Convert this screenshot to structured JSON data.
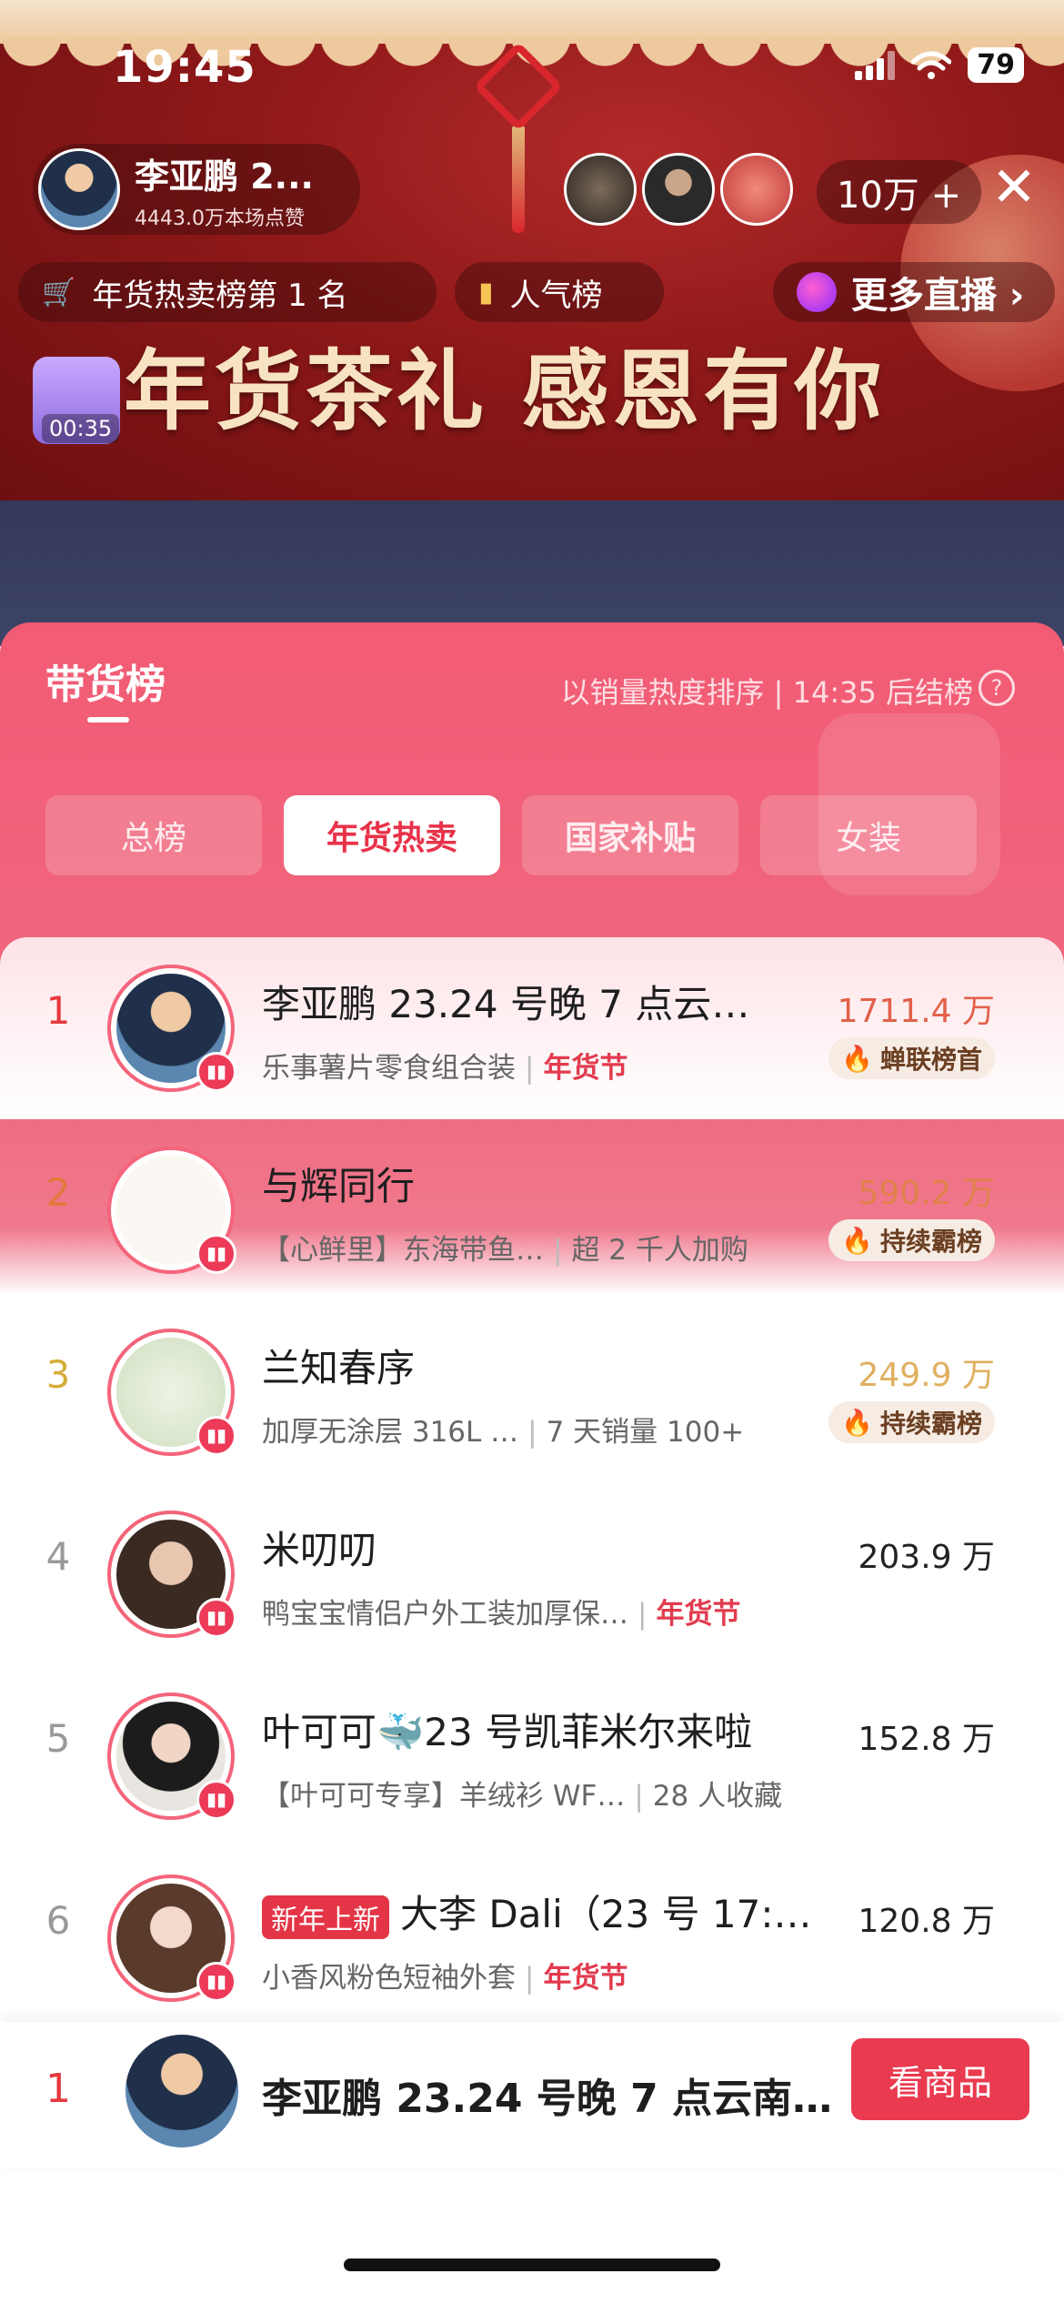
{
  "status_bar": {
    "time": "19:45",
    "battery": "79"
  },
  "host": {
    "name": "李亚鹏 2...",
    "likes": "4443.0万本场点赞"
  },
  "viewer_count": "10万 +",
  "chips": {
    "rank": "年货热卖榜第 1 名",
    "popularity": "人气榜",
    "more_live": "更多直播 ›"
  },
  "promo_text": "年货茶礼 感恩有你",
  "bag_timer": "00:35",
  "panel": {
    "title": "带货榜",
    "sort_text": "以销量热度排序 | 14:35 后结榜",
    "help": "?",
    "tabs": [
      "总榜",
      "年货热卖",
      "国家补贴",
      "女装"
    ]
  },
  "rankings": [
    {
      "rank": "1",
      "name": "李亚鹏 23.24 号晚 7 点云…",
      "desc": "乐事薯片零食组合装",
      "extra": "年货节",
      "value": "1711.4 万",
      "badge": "蝉联榜首"
    },
    {
      "rank": "2",
      "name": "与辉同行",
      "desc": "【心鲜里】东海带鱼…",
      "extra": "超 2 千人加购",
      "value": "590.2 万",
      "badge": "持续霸榜"
    },
    {
      "rank": "3",
      "name": "兰知春序",
      "desc": "加厚无涂层 316L …",
      "extra": "7 天销量 100+",
      "value": "249.9 万",
      "badge": "持续霸榜"
    },
    {
      "rank": "4",
      "name": "米叨叨",
      "desc": "鸭宝宝情侣户外工装加厚保…",
      "extra": "年货节",
      "value": "203.9 万"
    },
    {
      "rank": "5",
      "name": "叶可可🐳23 号凯菲米尔来啦",
      "desc": "【叶可可专享】羊绒衫 WF…",
      "extra": "28 人收藏",
      "value": "152.8 万"
    },
    {
      "rank": "6",
      "tag": "新年上新",
      "name": "大李 Dali（23 号 17:…",
      "desc": "小香风粉色短袖外套",
      "extra": "年货节",
      "value": "120.8 万"
    }
  ],
  "bottom": {
    "rank": "1",
    "name": "李亚鹏 23.24 号晚 7 点云南…",
    "button": "看商品"
  }
}
